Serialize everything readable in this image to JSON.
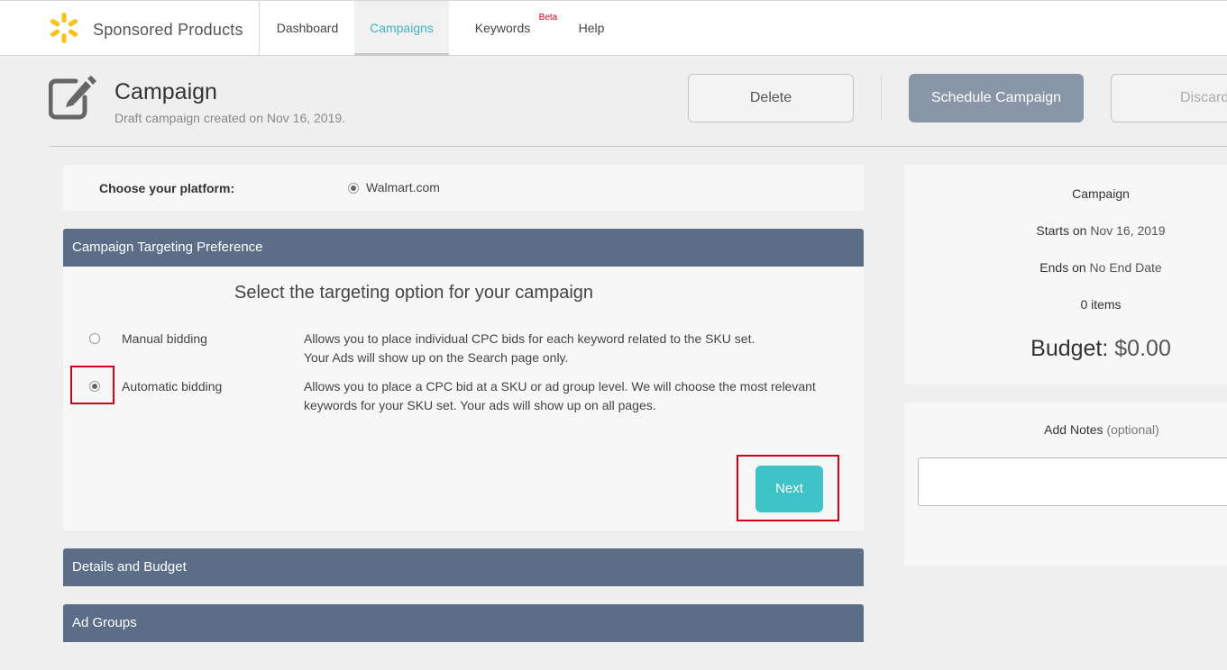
{
  "brand": {
    "name": "Sponsored Products"
  },
  "nav": {
    "items": [
      {
        "label": "Dashboard"
      },
      {
        "label": "Campaigns"
      },
      {
        "label": "Keywords",
        "badge": "Beta"
      },
      {
        "label": "Help"
      }
    ]
  },
  "header": {
    "title": "Campaign",
    "subtitle": "Draft campaign created on Nov 16, 2019.",
    "delete_label": "Delete",
    "schedule_label": "Schedule Campaign",
    "discard_label": "Discard"
  },
  "platform": {
    "label": "Choose your platform:",
    "value": "Walmart.com"
  },
  "targeting": {
    "section_title": "Campaign Targeting Preference",
    "prompt": "Select the targeting option for your campaign",
    "options": [
      {
        "label": "Manual bidding",
        "desc_line1": "Allows you to place individual CPC bids for each keyword related to the SKU set.",
        "desc_line2": "Your Ads will show up on the Search page only.",
        "selected": false
      },
      {
        "label": "Automatic bidding",
        "desc_line1": "Allows you to place a CPC bid at a SKU or ad group level. We will choose the most relevant",
        "desc_line2": "keywords for your SKU set. Your ads will show up on all pages.",
        "selected": true
      }
    ],
    "next_label": "Next"
  },
  "sections": {
    "details": "Details and Budget",
    "ad_groups": "Ad Groups"
  },
  "summary": {
    "title": "Campaign",
    "starts_prefix": "Starts on",
    "starts_value": "Nov 16, 2019",
    "ends_prefix": "Ends on",
    "ends_value": "No End Date",
    "items": "0 items",
    "budget_prefix": "Budget:",
    "budget_value": "$0.00"
  },
  "notes": {
    "label": "Add Notes",
    "optional": "(optional)",
    "value": ""
  },
  "colors": {
    "accent": "#3fb5c4",
    "section_header": "#5c6e87",
    "next_button": "#3ec4c6",
    "schedule_button": "#8896a8",
    "highlight": "#d0021b",
    "spark": "#f9c21a"
  },
  "icons": {
    "brand": "walmart-spark-icon",
    "header": "edit-pencil-icon"
  }
}
